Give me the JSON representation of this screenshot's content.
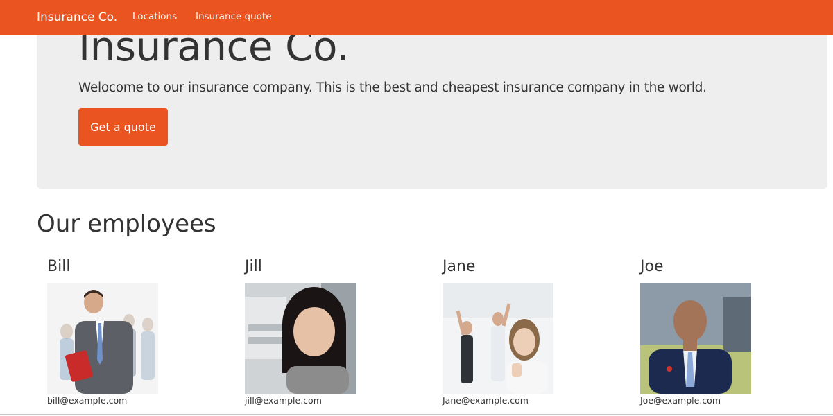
{
  "navbar": {
    "brand": "Insurance Co.",
    "links": [
      "Locations",
      "Insurance quote"
    ],
    "color": "#e95420"
  },
  "hero": {
    "title": "Insurance Co.",
    "lead": "Welocome to our insurance company. This is the best and cheapest insurance company in the world.",
    "button_label": "Get a quote"
  },
  "employees_section": {
    "title": "Our employees",
    "employees": [
      {
        "name": "Bill",
        "email": "bill@example.com",
        "photo_icon": "businessman-photo"
      },
      {
        "name": "Jill",
        "email": "jill@example.com",
        "photo_icon": "woman-office-photo"
      },
      {
        "name": "Jane",
        "email": "Jane@example.com",
        "photo_icon": "celebrating-team-photo"
      },
      {
        "name": "Joe",
        "email": "Joe@example.com",
        "photo_icon": "man-in-suit-photo"
      }
    ]
  }
}
